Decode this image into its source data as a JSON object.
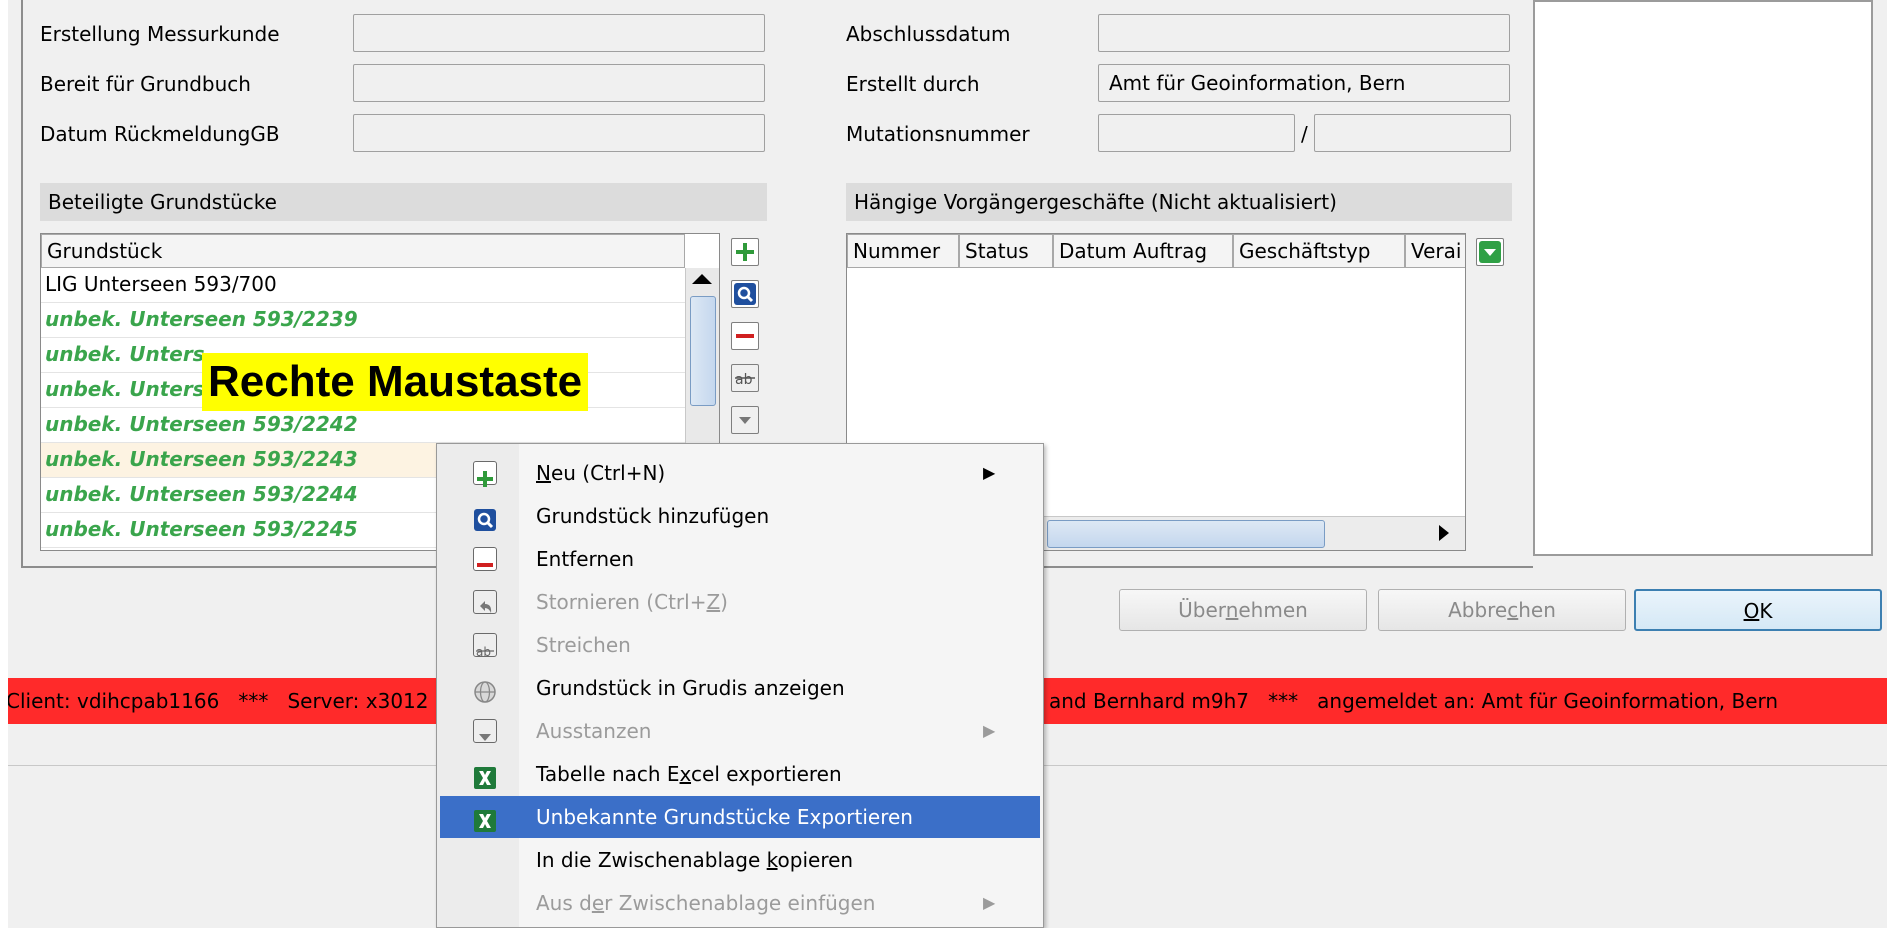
{
  "form": {
    "left_labels": [
      "Erstellung Messurkunde",
      "Bereit für Grundbuch",
      "Datum RückmeldungGB"
    ],
    "right_labels": [
      "Abschlussdatum",
      "Erstellt durch",
      "Mutationsnummer"
    ],
    "erstellt_durch_value": "Amt für Geoinformation, Bern",
    "mutation_separator": "/"
  },
  "grundstuecke": {
    "section_title": "Beteiligte Grundstücke",
    "column_header": "Grundstück",
    "rows": [
      "LIG Unterseen 593/700",
      "unbek. Unterseen 593/2239",
      "unbek. Unters",
      "unbek. Unters",
      "unbek. Unterseen 593/2242",
      "unbek. Unterseen 593/2243",
      "unbek. Unterseen 593/2244",
      "unbek. Unterseen 593/2245"
    ]
  },
  "annotation": {
    "text": "Rechte Maustaste",
    "color": "#ffff00"
  },
  "vorgaenger": {
    "section_title": "Hängige Vorgängergeschäfte (Nicht aktualisiert)",
    "columns": [
      "Nummer",
      "Status",
      "Datum Auftrag",
      "Geschäftstyp",
      "Verai"
    ]
  },
  "buttons": {
    "uebernehmen_pre": "Über",
    "uebernehmen_key": "n",
    "uebernehmen_post": "ehmen",
    "abbrechen_pre": "Abbre",
    "abbrechen_key": "c",
    "abbrechen_post": "hen",
    "ok_key": "O",
    "ok_post": "K"
  },
  "statusbar": {
    "left": "Client: vdihcpab1166   ***   Server: x3012",
    "right": "and Bernhard m9h7   ***   angemeldet an: Amt für Geoinformation, Bern",
    "color": "#ff2a2a"
  },
  "context_menu": {
    "items": [
      {
        "pre": "",
        "key": "N",
        "post": "eu (Ctrl+N)",
        "icon": "plus-icon",
        "enabled": true,
        "submenu": true
      },
      {
        "pre": "Grundstück hinzufügen",
        "key": "",
        "post": "",
        "icon": "search-icon",
        "enabled": true,
        "submenu": false
      },
      {
        "pre": "Entfernen",
        "key": "",
        "post": "",
        "icon": "minus-icon",
        "enabled": true,
        "submenu": false
      },
      {
        "pre": "Stornieren (Ctrl+",
        "key": "Z",
        "post": ")",
        "icon": "undo-icon",
        "enabled": false,
        "submenu": false
      },
      {
        "pre": "Streichen",
        "key": "",
        "post": "",
        "icon": "strike-text-icon",
        "enabled": false,
        "submenu": false
      },
      {
        "pre": "Grundstück in Grudis anzeigen",
        "key": "",
        "post": "",
        "icon": "globe-icon",
        "enabled": true,
        "submenu": false
      },
      {
        "pre": "Ausstanzen",
        "key": "",
        "post": "",
        "icon": "dropdown-icon",
        "enabled": false,
        "submenu": true
      },
      {
        "pre": "Tabelle nach E",
        "key": "x",
        "post": "cel exportieren",
        "icon": "excel-icon",
        "enabled": true,
        "submenu": false
      },
      {
        "pre": "Unbekannte Grundstücke Exportieren",
        "key": "",
        "post": "",
        "icon": "excel-icon",
        "enabled": true,
        "submenu": false,
        "selected": true
      },
      {
        "pre": "In die Zwischenablage ",
        "key": "k",
        "post": "opieren",
        "icon": "",
        "enabled": true,
        "submenu": false
      },
      {
        "pre": "Aus d",
        "key": "e",
        "post": "r Zwischenablage einfügen",
        "icon": "",
        "enabled": false,
        "submenu": true
      }
    ]
  },
  "colors": {
    "accent": "#3b6fc8",
    "green_text": "#3aa54c",
    "status_red": "#ff2a2a"
  }
}
